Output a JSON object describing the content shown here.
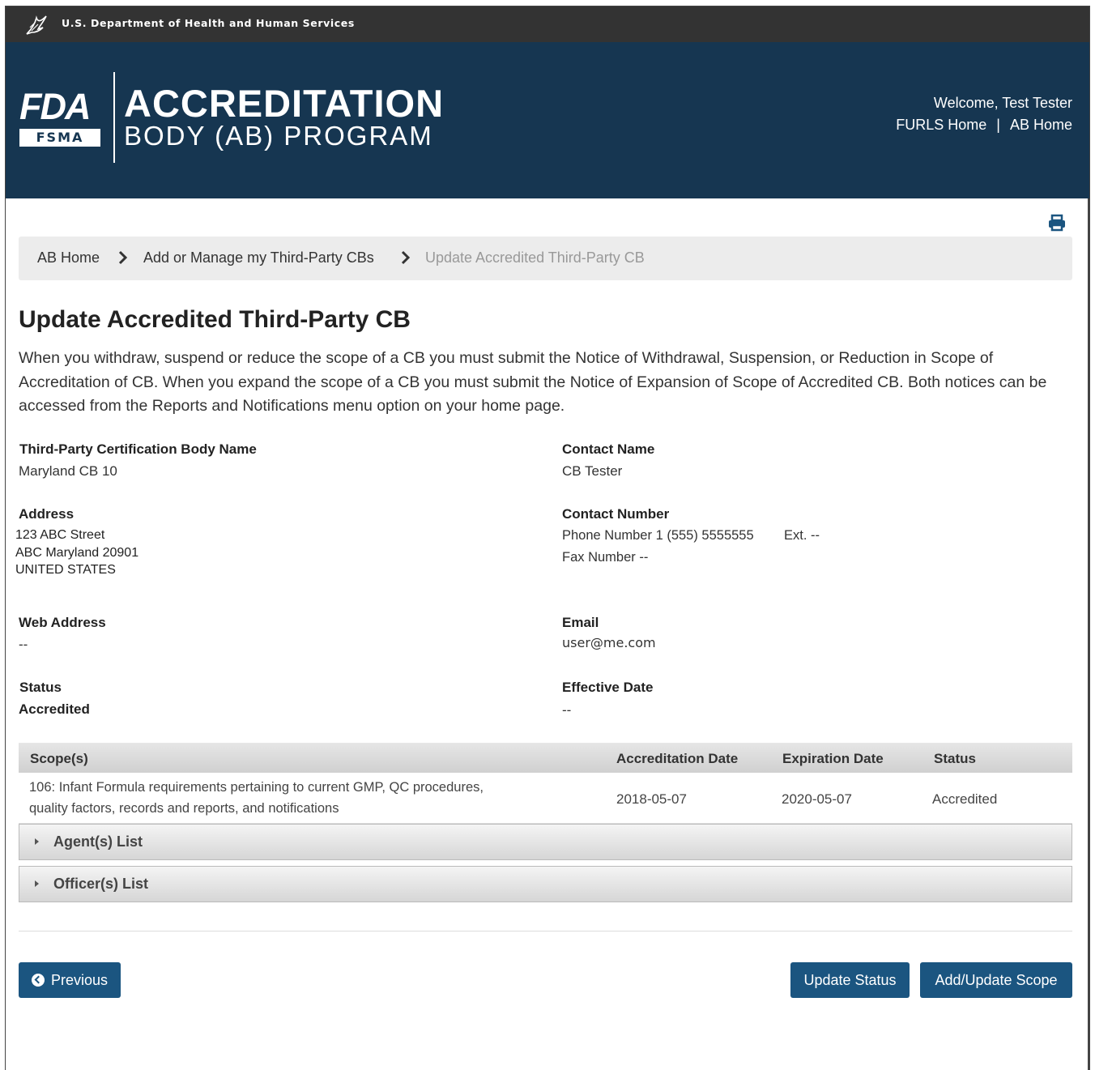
{
  "hhs_bar": {
    "text": "U.S. Department of Health and Human Services"
  },
  "header": {
    "logo_fda": "FDA",
    "logo_fsma": "FSMA",
    "title_line1": "ACCREDITATION",
    "title_line2": "BODY (AB) PROGRAM",
    "welcome": "Welcome, Test Tester",
    "links": [
      "FURLS Home",
      "AB Home"
    ],
    "link_separator": "|"
  },
  "breadcrumb": {
    "items": [
      "AB Home",
      "Add or Manage my Third-Party CBs",
      "Update Accredited Third-Party CB"
    ]
  },
  "page": {
    "title": "Update Accredited Third-Party CB",
    "intro": "When you withdraw, suspend or reduce the scope of a CB you must submit the Notice of Withdrawal, Suspension, or Reduction in Scope of Accreditation of CB. When you expand the scope of a CB you must submit the Notice of Expansion of Scope of Accredited CB. Both notices can be accessed from the Reports and Notifications menu option on your home page."
  },
  "details": {
    "cb_name_label": "Third-Party Certification Body Name",
    "cb_name_value": "Maryland CB 10",
    "contact_name_label": "Contact Name",
    "contact_name_value": "CB Tester",
    "address_label": "Address",
    "address_lines": [
      "123 ABC Street",
      "ABC Maryland 20901",
      "UNITED STATES"
    ],
    "contact_number_label": "Contact Number",
    "phone": "Phone Number 1 (555) 5555555",
    "ext": "Ext. --",
    "fax": "Fax Number --",
    "web_label": "Web Address",
    "web_value": "--",
    "email_label": "Email",
    "email_value": "user@me.com",
    "status_label": "Status",
    "status_value": "Accredited",
    "effective_label": "Effective Date",
    "effective_value": "--"
  },
  "scope_table": {
    "headers": [
      "Scope(s)",
      "Accreditation Date",
      "Expiration Date",
      "Status"
    ],
    "rows": [
      {
        "scope_line1": "106: Infant Formula requirements pertaining to current GMP, QC procedures,",
        "scope_line2": "quality factors, records and reports, and notifications",
        "accreditation_date": "2018-05-07",
        "expiration_date": "2020-05-07",
        "status": "Accredited"
      }
    ]
  },
  "accordions": [
    "Agent(s) List",
    "Officer(s) List"
  ],
  "buttons": {
    "previous": "Previous",
    "update_status": "Update Status",
    "add_update_scope": "Add/Update Scope"
  },
  "colors": {
    "banner": "#163651",
    "hhs_bar": "#333333",
    "button": "#1b5580"
  }
}
